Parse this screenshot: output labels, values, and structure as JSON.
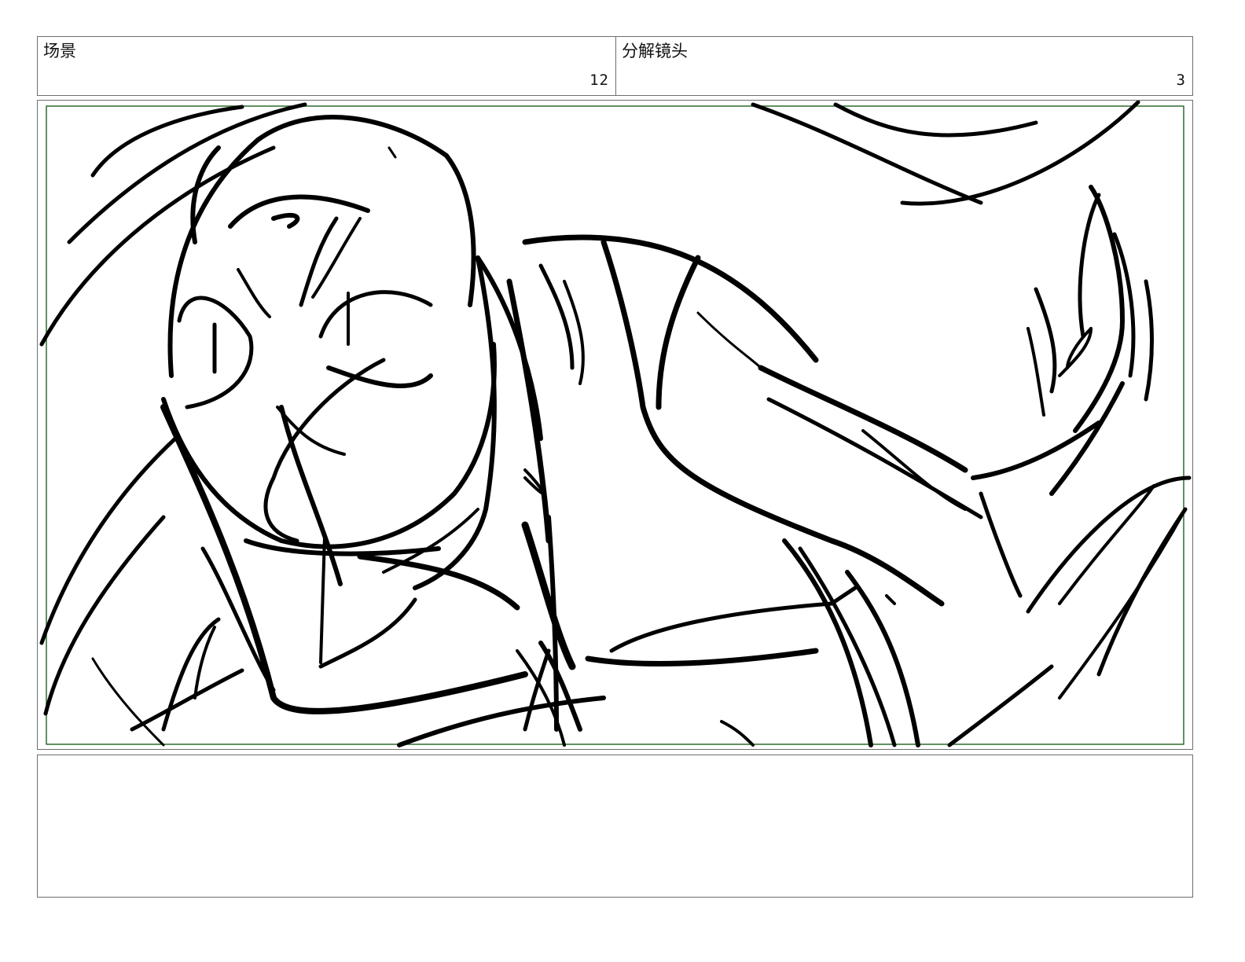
{
  "header": {
    "scene_label": "场景",
    "scene_number": "12",
    "panel_label": "分解镜头",
    "panel_number": "3"
  },
  "panel": {
    "sketch_description": "",
    "safe_frame_color": "#2f6b2f",
    "line_color": "#000000"
  },
  "notes": {
    "text": ""
  }
}
